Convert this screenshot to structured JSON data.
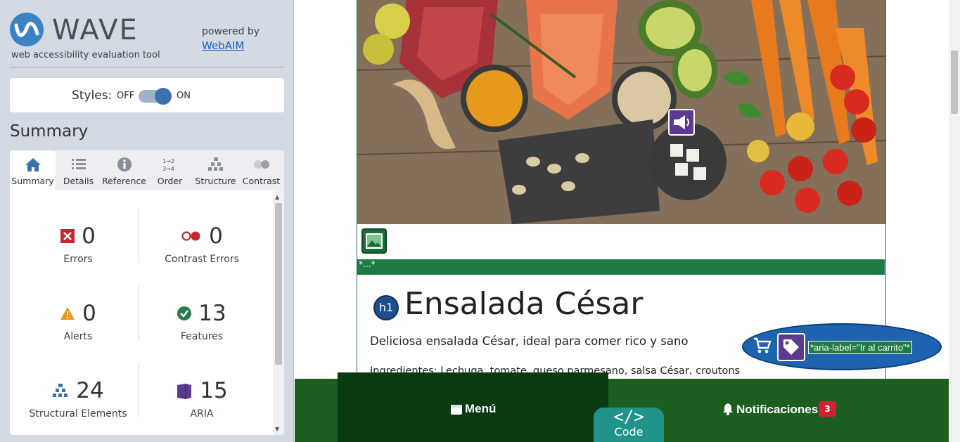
{
  "wave": {
    "name": "WAVE",
    "tagline": "web accessibility evaluation tool",
    "powered_by": "powered by",
    "webaim_link": "WebAIM",
    "styles_label": "Styles:",
    "styles_off": "OFF",
    "styles_on": "ON",
    "summary_title": "Summary",
    "tabs": [
      {
        "label": "Summary",
        "icon": "home-icon"
      },
      {
        "label": "Details",
        "icon": "list-icon"
      },
      {
        "label": "Reference",
        "icon": "info-icon"
      },
      {
        "label": "Order",
        "icon": "order-icon"
      },
      {
        "label": "Structure",
        "icon": "structure-icon"
      },
      {
        "label": "Contrast",
        "icon": "contrast-icon"
      }
    ],
    "stats": {
      "errors": {
        "count": "0",
        "label": "Errors"
      },
      "contrast_errors": {
        "count": "0",
        "label": "Contrast Errors"
      },
      "alerts": {
        "count": "0",
        "label": "Alerts"
      },
      "features": {
        "count": "13",
        "label": "Features"
      },
      "structural": {
        "count": "24",
        "label": "Structural Elements"
      },
      "aria": {
        "count": "15",
        "label": "ARIA"
      }
    }
  },
  "page": {
    "alt_text": "*...*",
    "h1_badge": "h1",
    "title": "Ensalada César",
    "description": "Deliciosa ensalada César, ideal para comer rico y sano",
    "ingredients": "Ingredientes: Lechuga, tomate, queso parmesano, salsa César, croutons",
    "aria_label_text": "*aria-label=\"Ir al carrito\"*",
    "nav": {
      "menu_label": "Menú",
      "notifications_label": "Notificaciones",
      "notifications_count": "3",
      "code_icon": "</>",
      "code_label": "Code"
    }
  },
  "colors": {
    "wave_blue": "#3b82c4",
    "nav_green": "#1b5e20",
    "menu_dark_green": "#0a3a12",
    "code_teal": "#20938a",
    "aria_purple": "#5b3a8f",
    "badge_red": "#d3212f"
  }
}
